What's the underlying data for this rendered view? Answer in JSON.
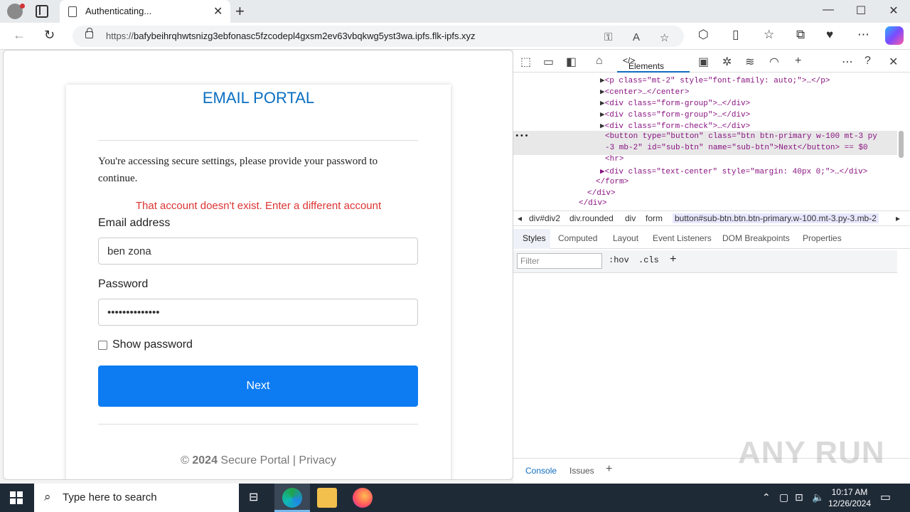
{
  "browser": {
    "tab_title": "Authenticating...",
    "tab_close": "✕",
    "new_tab": "+",
    "url_proto": "https://",
    "url_rest": "bafybeihrqhwtsnizg3ebfonasc5fzcodepl4gxsm2ev63vbqkwg5yst3wa.ipfs.flk-ipfs.xyz",
    "window_min": "—",
    "window_max": "☐",
    "window_close": "✕"
  },
  "page": {
    "heading": "EMAIL PORTAL",
    "message": "You're accessing secure settings, please provide your password to continue.",
    "error": "That account doesn't exist. Enter a different account",
    "email_label": "Email address",
    "email_value": "ben zona",
    "password_label": "Password",
    "password_value": "••••••••••••••",
    "show_password_label": "Show password",
    "next_button": "Next",
    "footer_copy": "©",
    "footer_year": "2024",
    "footer_name": "Secure Portal",
    "footer_sep": "|",
    "footer_privacy": "Privacy"
  },
  "devtools": {
    "elements_tab": "Elements",
    "code_lines": [
      {
        "text_pre": "▶",
        "html": "<p class=\"mt-2\" style=\"font-family: auto;\">…</p>"
      },
      {
        "text_pre": "▶",
        "html": "<center>…</center>"
      },
      {
        "text_pre": "▶",
        "html": "<div class=\"form-group\">…</div>"
      },
      {
        "text_pre": "▶",
        "html": "<div class=\"form-group\">…</div>"
      },
      {
        "text_pre": "▶",
        "html": "<div class=\"form-check\">…</div>"
      }
    ],
    "selected_line1": "<button type=\"button\" class=\"btn btn-primary w-100 mt-3 py",
    "selected_line2": "-3 mb-2\" id=\"sub-btn\" name=\"sub-btn\">Next</button> == $0",
    "line_hr": "<hr>",
    "line_div_center": "▶<div class=\"text-center\" style=\"margin: 40px 0;\">…</div>",
    "line_form_close": "</form>",
    "line_div_close1": "</div>",
    "line_div_close2": "</div>",
    "ellipsis_marker": "•••",
    "breadcrumbs": [
      "div#div2",
      "div.rounded",
      "div",
      "form",
      "button#sub-btn.btn.btn-primary.w-100.mt-3.py-3.mb-2"
    ],
    "subtabs": [
      "Styles",
      "Computed",
      "Layout",
      "Event Listeners",
      "DOM Breakpoints",
      "Properties"
    ],
    "filter_placeholder": "Filter",
    "hov": ":hov",
    "cls": ".cls",
    "plus": "+",
    "drawer_tabs": [
      "Console",
      "Issues"
    ]
  },
  "watermark": "ANY RUN",
  "taskbar": {
    "search_placeholder": "Type here to search",
    "time": "10:17 AM",
    "date": "12/26/2024"
  }
}
